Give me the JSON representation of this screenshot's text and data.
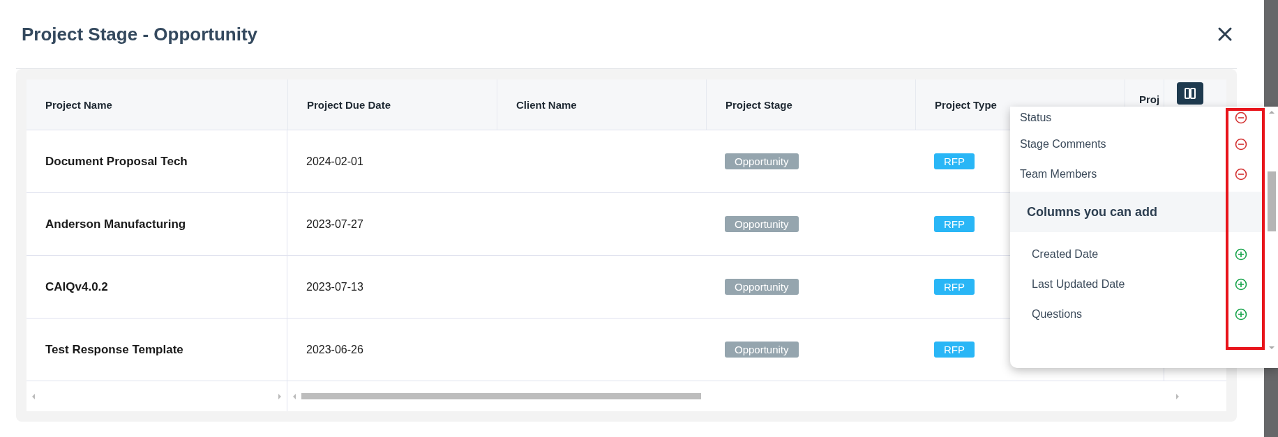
{
  "dialog": {
    "title": "Project Stage - Opportunity"
  },
  "table": {
    "columns": [
      "Project Name",
      "Project Due Date",
      "Client Name",
      "Project Stage",
      "Project Type",
      "Proj"
    ],
    "rows": [
      {
        "project_name": "Document Proposal Tech",
        "due_date": "2024-02-01",
        "stage": "Opportunity",
        "type": "RFP"
      },
      {
        "project_name": "Anderson Manufacturing",
        "due_date": "2023-07-27",
        "stage": "Opportunity",
        "type": "RFP"
      },
      {
        "project_name": "CAIQv4.0.2",
        "due_date": "2023-07-13",
        "stage": "Opportunity",
        "type": "RFP"
      },
      {
        "project_name": "Test Response Template",
        "due_date": "2023-06-26",
        "stage": "Opportunity",
        "type": "RFP"
      }
    ]
  },
  "column_menu": {
    "current_columns": [
      {
        "label": "Status",
        "kind": "remove"
      },
      {
        "label": "Stage Comments",
        "kind": "remove"
      },
      {
        "label": "Team Members",
        "kind": "remove"
      }
    ],
    "available_section": {
      "title": "Columns you can add",
      "columns": [
        {
          "label": "Created Date",
          "kind": "add"
        },
        {
          "label": "Last Updated Date",
          "kind": "add"
        },
        {
          "label": "Questions",
          "kind": "add"
        }
      ]
    }
  }
}
